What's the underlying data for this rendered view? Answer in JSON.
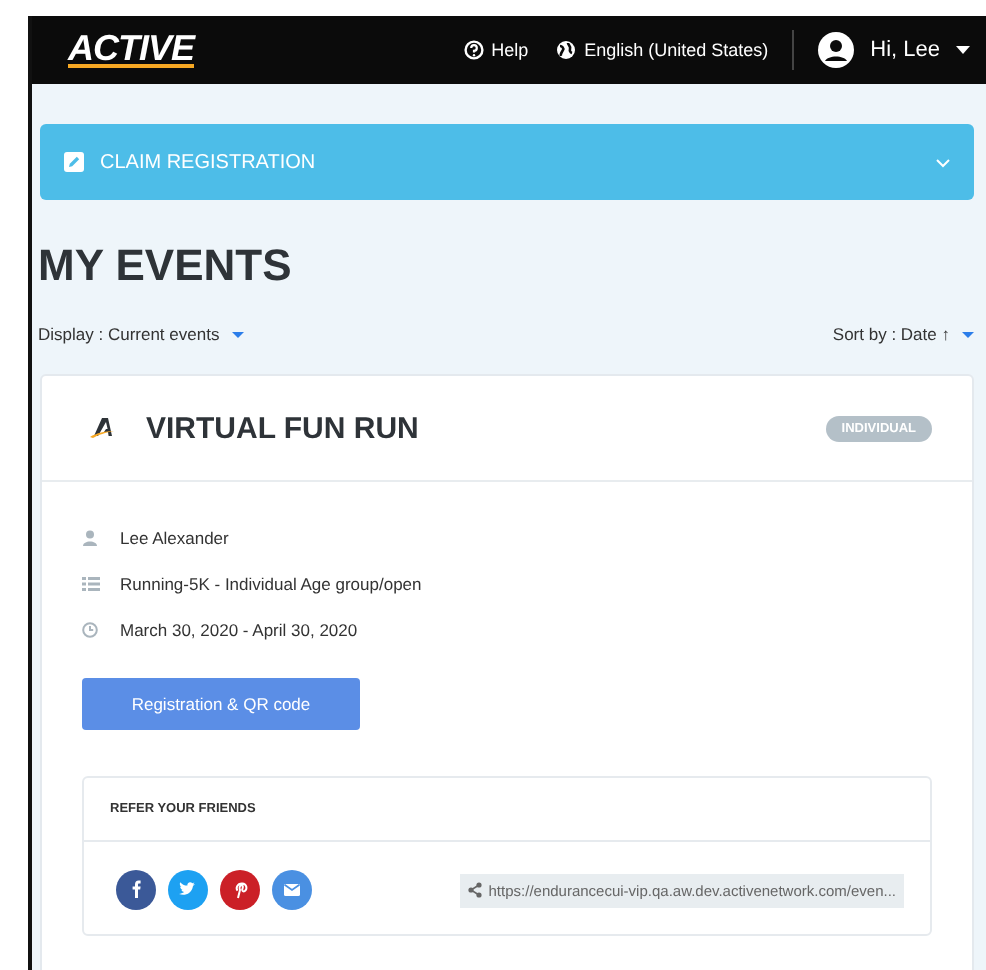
{
  "header": {
    "logo": "ACTIVE",
    "help": "Help",
    "language": "English (United States)",
    "user": "Hi, Lee"
  },
  "claim": {
    "label": "CLAIM REGISTRATION",
    "expanded": false
  },
  "title": "MY EVENTS",
  "display": {
    "label": "Display :",
    "value": "Current events"
  },
  "sort": {
    "label": "Sort by :",
    "value": "Date ↑"
  },
  "events": [
    {
      "title": "VIRTUAL FUN RUN",
      "badge": "INDIVIDUAL",
      "details": [
        {
          "kind": "person",
          "text": "Lee Alexander"
        },
        {
          "kind": "list",
          "text": "Running-5K - Individual Age group/open"
        },
        {
          "kind": "clock",
          "text": "March 30, 2020 - April 30, 2020"
        }
      ],
      "button": "Registration & QR code",
      "refer": {
        "title": "REFER YOUR FRIENDS",
        "shares": [
          {
            "kind": "facebook",
            "color": "#3b5998"
          },
          {
            "kind": "twitter",
            "color": "#1da1f2"
          },
          {
            "kind": "pinterest",
            "color": "#cb2027"
          },
          {
            "kind": "email",
            "color": "#4a90e2"
          }
        ],
        "link": "https://endurancecui-vip.qa.aw.dev.activenetwork.com/even..."
      }
    }
  ]
}
